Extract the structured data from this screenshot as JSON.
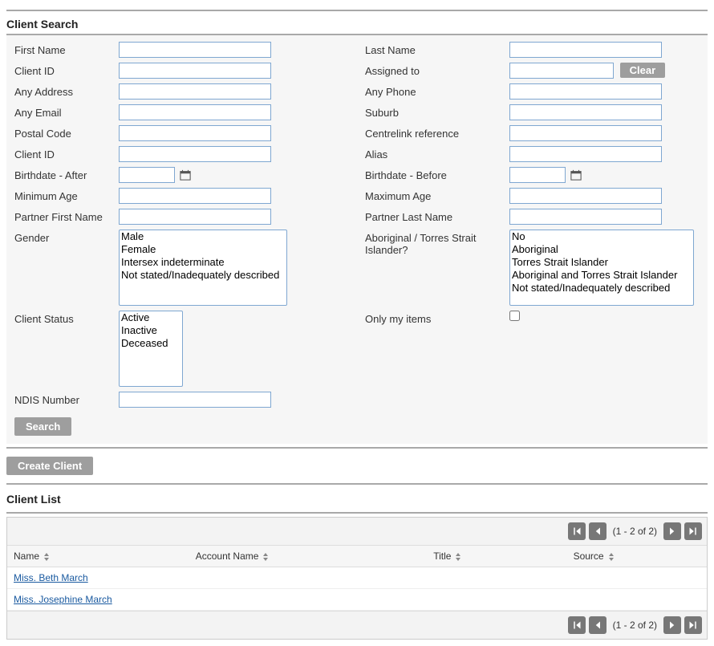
{
  "titles": {
    "search": "Client Search",
    "list": "Client List"
  },
  "labels": {
    "first_name": "First Name",
    "last_name": "Last Name",
    "client_id": "Client ID",
    "assigned_to": "Assigned to",
    "any_address": "Any Address",
    "any_phone": "Any Phone",
    "any_email": "Any Email",
    "suburb": "Suburb",
    "postal_code": "Postal Code",
    "centrelink": "Centrelink reference",
    "client_id2": "Client ID",
    "alias": "Alias",
    "birthdate_after": "Birthdate - After",
    "birthdate_before": "Birthdate - Before",
    "min_age": "Minimum Age",
    "max_age": "Maximum Age",
    "partner_first": "Partner First Name",
    "partner_last": "Partner Last Name",
    "gender": "Gender",
    "atsi": "Aboriginal / Torres Strait Islander?",
    "client_status": "Client Status",
    "only_my_items": "Only my items",
    "ndis_number": "NDIS Number"
  },
  "buttons": {
    "clear": "Clear",
    "search": "Search",
    "create_client": "Create Client"
  },
  "options": {
    "gender": [
      "Male",
      "Female",
      "Intersex indeterminate",
      "Not stated/Inadequately described"
    ],
    "atsi": [
      "No",
      "Aboriginal",
      "Torres Strait Islander",
      "Aboriginal and Torres Strait Islander",
      "Not stated/Inadequately described"
    ],
    "client_status": [
      "Active",
      "Inactive",
      "Deceased"
    ]
  },
  "values": {
    "first_name": "",
    "last_name": "",
    "client_id": "",
    "assigned_to": "",
    "any_address": "",
    "any_phone": "",
    "any_email": "",
    "suburb": "",
    "postal_code": "",
    "centrelink": "",
    "client_id2": "",
    "alias": "",
    "birthdate_after": "",
    "birthdate_before": "",
    "min_age": "",
    "max_age": "",
    "partner_first": "",
    "partner_last": "",
    "ndis_number": "",
    "only_my_items": false
  },
  "list": {
    "pager_range": "(1 - 2 of 2)",
    "columns": [
      "Name",
      "Account Name",
      "Title",
      "Source"
    ],
    "rows": [
      {
        "name": "Miss. Beth March",
        "account_name": "",
        "title": "",
        "source": ""
      },
      {
        "name": "Miss. Josephine March",
        "account_name": "",
        "title": "",
        "source": ""
      }
    ]
  }
}
